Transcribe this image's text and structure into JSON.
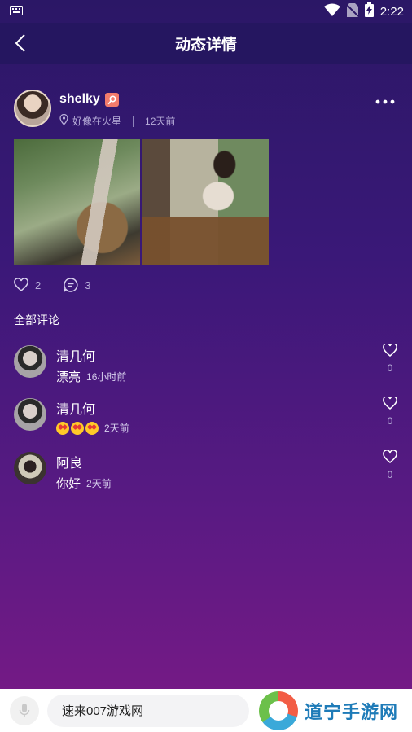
{
  "status_bar": {
    "time": "2:22"
  },
  "header": {
    "title": "动态详情"
  },
  "post": {
    "author": "shelky",
    "location": "好像在火星",
    "time": "12天前",
    "likes": "2",
    "comments": "3"
  },
  "comments_section": {
    "title": "全部评论",
    "items": [
      {
        "name": "清几何",
        "text": "漂亮",
        "time": "16小时前",
        "likes": "0"
      },
      {
        "name": "清几何",
        "text": "",
        "time": "2天前",
        "likes": "0"
      },
      {
        "name": "阿良",
        "text": "你好",
        "time": "2天前",
        "likes": "0"
      }
    ]
  },
  "bottom": {
    "input_placeholder": "速来007游戏网",
    "watermark": "道宁手游网"
  },
  "colors": {
    "accent": "#f37b6b",
    "bg_top": "#2b1766",
    "bg_bottom": "#7a1a86"
  }
}
